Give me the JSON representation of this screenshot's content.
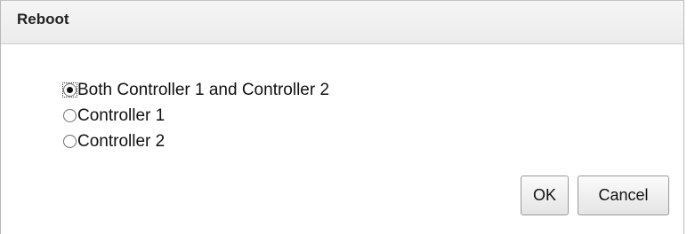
{
  "dialog": {
    "title": "Reboot"
  },
  "options": [
    {
      "label": "Both Controller 1 and Controller 2",
      "checked": true
    },
    {
      "label": "Controller 1",
      "checked": false
    },
    {
      "label": "Controller 2",
      "checked": false
    }
  ],
  "buttons": {
    "ok_label": "OK",
    "cancel_label": "Cancel"
  }
}
